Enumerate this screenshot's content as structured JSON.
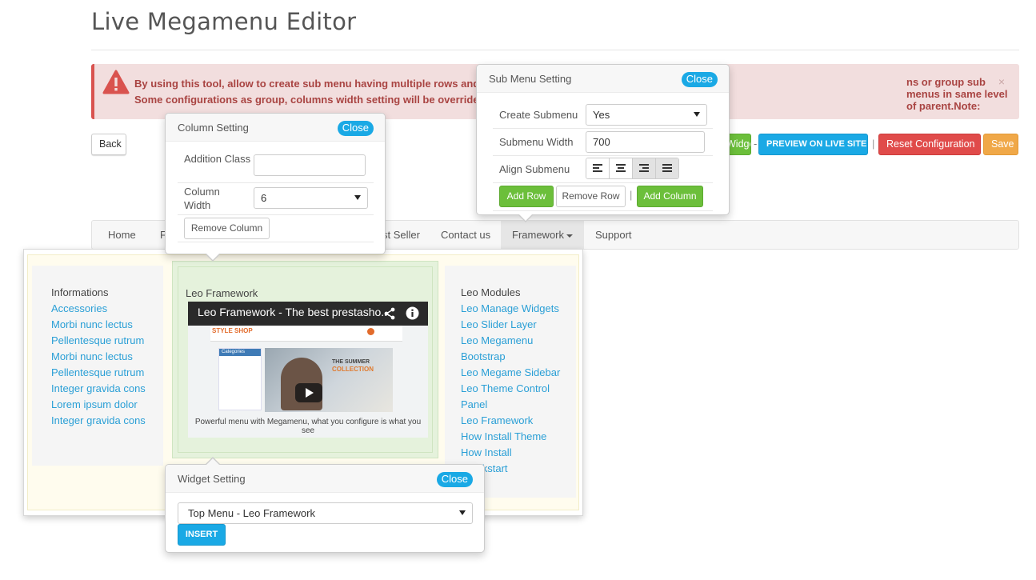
{
  "page_title": "Live Megamenu Editor",
  "alert": {
    "line1_left": "By using this tool, allow to create sub menu having multiple rows and m",
    "line1_right": "ns or group sub menus in same level of parent.Note:",
    "line2": "Some configurations as group, columns width setting will be overrided",
    "close": "×"
  },
  "toolbar": {
    "back": "Back",
    "widget": "Widget",
    "separator_dash": "-",
    "preview": "PREVIEW ON LIVE SITE",
    "separator_pipe": "|",
    "reset": "Reset Configuration",
    "save": "Save"
  },
  "nav": {
    "items": [
      "Home",
      "Fe",
      "st Seller",
      "Contact us",
      "Framework",
      "Support"
    ]
  },
  "mega": {
    "col1": {
      "title": "Informations",
      "links": [
        "Accessories",
        "Morbi nunc lectus",
        "Pellentesque rutrum",
        "Morbi nunc lectus",
        "Pellentesque rutrum",
        "Integer gravida cons",
        "Lorem ipsum dolor",
        "Integer gravida cons"
      ]
    },
    "col2": {
      "title": "Leo Framework",
      "video_title": "Leo Framework - The best prestasho...",
      "video_caption": "Powerful menu with Megamenu, what you configure is what you see",
      "mock_logo": "STYLE SHOP",
      "mock_summer": "THE SUMMER",
      "mock_collection": "COLLECTION",
      "mock_sidebar": "Categories"
    },
    "col3": {
      "title": "Leo Modules",
      "links": [
        "Leo Manage Widgets",
        "Leo Slider Layer",
        "Leo Megamenu",
        "Bootstrap",
        "Leo Megame Sidebar",
        "Leo Theme Control",
        "Panel",
        "Leo Framework",
        "How Install Theme",
        "How Install",
        "Quickstart"
      ]
    }
  },
  "submenu_setting": {
    "title": "Sub Menu Setting",
    "close": "Close",
    "create_label": "Create Submenu",
    "create_value": "Yes",
    "width_label": "Submenu Width",
    "width_value": "700",
    "align_label": "Align Submenu",
    "align_icons": [
      "align-left-icon",
      "align-center-icon",
      "align-right-icon",
      "align-justify-icon"
    ],
    "add_row": "Add Row",
    "remove_row": "Remove Row",
    "pipe": "|",
    "add_column": "Add Column"
  },
  "column_setting": {
    "title": "Column Setting",
    "close": "Close",
    "class_label": "Addition Class",
    "class_value": "",
    "width_label": "Column Width",
    "width_value": "6",
    "remove": "Remove Column"
  },
  "widget_setting": {
    "title": "Widget Setting",
    "close": "Close",
    "select_value": "Top Menu - Leo Framework",
    "insert": "INSERT"
  },
  "colors": {
    "accent_blue": "#1aa9e5",
    "green": "#6cbf3b",
    "red": "#e04b4a",
    "orange": "#f0a848",
    "link": "#2a9fd6",
    "alert_text": "#a94442"
  }
}
